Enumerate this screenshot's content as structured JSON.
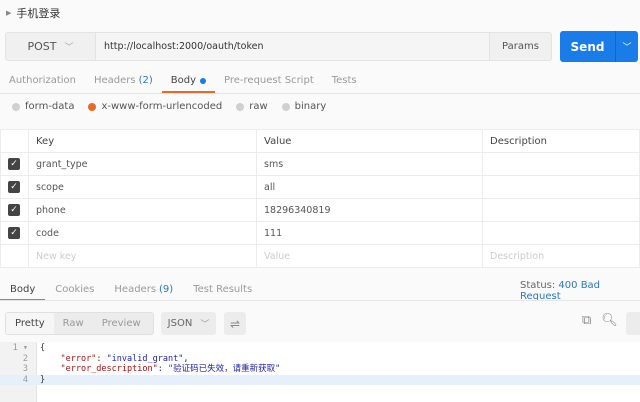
{
  "request_name": "手机登录",
  "method": "POST",
  "url": "http://localhost:2000/oauth/token",
  "params_label": "Params",
  "send_label": "Send",
  "request_tabs": [
    {
      "label": "Authorization"
    },
    {
      "label": "Headers",
      "count": "(2)"
    },
    {
      "label": "Body"
    },
    {
      "label": "Pre-request Script"
    },
    {
      "label": "Tests"
    }
  ],
  "body_types": [
    "form-data",
    "x-www-form-urlencoded",
    "raw",
    "binary"
  ],
  "table": {
    "headers": [
      "Key",
      "Value",
      "Description"
    ],
    "rows": [
      {
        "key": "grant_type",
        "value": "sms"
      },
      {
        "key": "scope",
        "value": "all"
      },
      {
        "key": "phone",
        "value": "18296340819"
      },
      {
        "key": "code",
        "value": "111"
      }
    ],
    "placeholders": {
      "key": "New key",
      "value": "Value",
      "description": "Description"
    }
  },
  "response_tabs": [
    {
      "label": "Body"
    },
    {
      "label": "Cookies"
    },
    {
      "label": "Headers",
      "count": "(9)"
    },
    {
      "label": "Test Results"
    }
  ],
  "status_label": "Status:",
  "status_value": "400 Bad Request",
  "view_modes": [
    "Pretty",
    "Raw",
    "Preview"
  ],
  "format": "JSON",
  "response_lines": {
    "n": [
      "1",
      "2",
      "3",
      "4"
    ],
    "open": "{",
    "error_key": "\"error\"",
    "error_val": "\"invalid_grant\"",
    "desc_key": "\"error_description\"",
    "desc_val": "\"验证码已失效，请重新获取\"",
    "close": "}"
  }
}
